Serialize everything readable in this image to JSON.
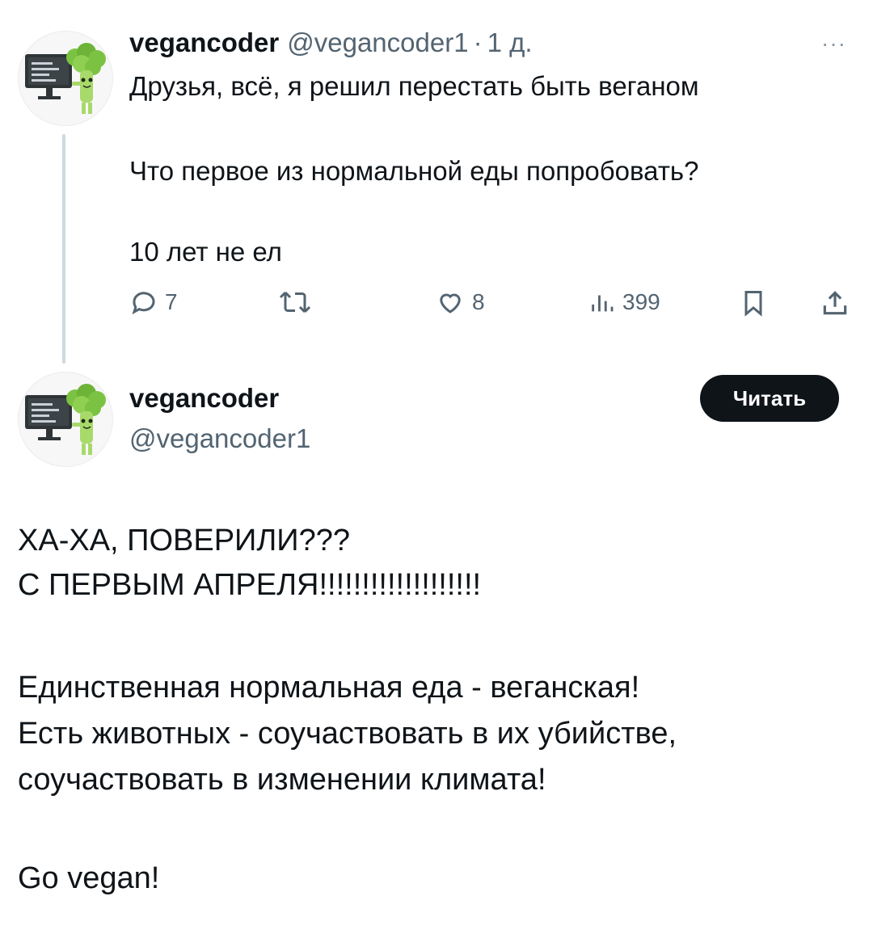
{
  "tweet1": {
    "name": "vegancoder",
    "handle": "@vegancoder1",
    "separator": "·",
    "time": "1 д.",
    "more_icon": "···",
    "lines": [
      "Друзья, всё, я решил перестать быть веганом",
      "Что первое из нормальной еды попробовать?",
      "10 лет не ел"
    ],
    "actions": {
      "replies": "7",
      "likes": "8",
      "views": "399"
    }
  },
  "tweet2": {
    "name": "vegancoder",
    "handle": "@vegancoder1",
    "follow_label": "Читать",
    "lines": [
      "ХА-ХА, ПОВЕРИЛИ???",
      "С ПЕРВЫМ АПРЕЛЯ!!!!!!!!!!!!!!!!!!!",
      "Единственная нормальная еда - веганская!",
      "Есть животных - соучаствовать в их убийстве,",
      "соучаствовать в изменении климата!",
      "Go vegan!"
    ]
  },
  "colors": {
    "text": "#0f1419",
    "muted": "#536471",
    "button": "#0f1419",
    "broccoli": "#7cc242"
  },
  "icons": [
    "reply-icon",
    "retweet-icon",
    "like-icon",
    "views-icon",
    "bookmark-icon",
    "share-icon",
    "more-icon",
    "avatar-broccoli-icon"
  ]
}
